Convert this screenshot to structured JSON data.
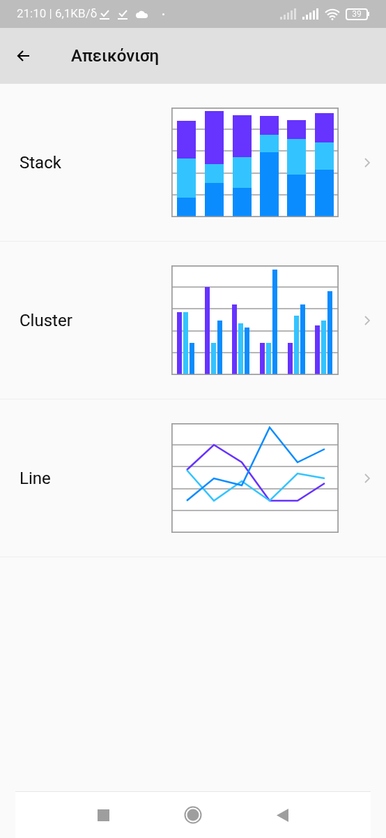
{
  "status_bar": {
    "time": "21:10 | 6,1KB/δ",
    "battery": "39"
  },
  "header": {
    "title": "Απεικόνιση"
  },
  "items": [
    {
      "label": "Stack",
      "kind": "stack"
    },
    {
      "label": "Cluster",
      "kind": "cluster"
    },
    {
      "label": "Line",
      "kind": "line"
    }
  ]
}
